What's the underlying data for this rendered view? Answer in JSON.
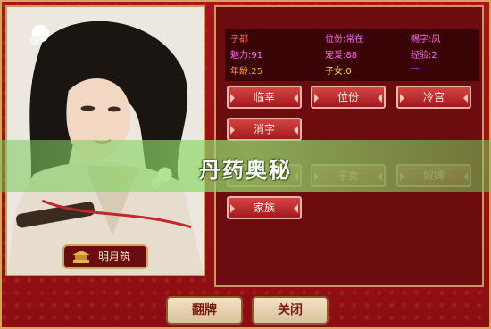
{
  "character": {
    "name": "明月筑"
  },
  "stats": [
    {
      "text": "子都",
      "color": "#ff6666"
    },
    {
      "text": "位份:常在",
      "color": "#ff66ff"
    },
    {
      "text": "赐字:凤",
      "color": "#ff66ff"
    },
    {
      "text": "魅力:91",
      "color": "#ff66ff"
    },
    {
      "text": "宠爱:88",
      "color": "#ff66ff"
    },
    {
      "text": "经验:2",
      "color": "#ff66ff"
    },
    {
      "text": "年龄:25",
      "color": "#ff9933"
    },
    {
      "text": "子女:0",
      "color": "#ffd24a"
    },
    {
      "text": "—",
      "color": "#6b6bff"
    }
  ],
  "actions": {
    "row1": [
      "临幸",
      "位份",
      "冷宫"
    ],
    "row2": [
      "消字"
    ],
    "row3": [
      "",
      "子女",
      "奴婢"
    ],
    "row4": [
      "家族"
    ]
  },
  "banner": {
    "text": "丹药奥秘"
  },
  "bottom": {
    "flip_label": "翻牌",
    "close_label": "关闭"
  },
  "colors": {
    "frame": "#a8151a",
    "button": "#c42b2f",
    "banner_green": "#8fd46a"
  },
  "icons": {
    "nameplate": "palace-icon"
  }
}
